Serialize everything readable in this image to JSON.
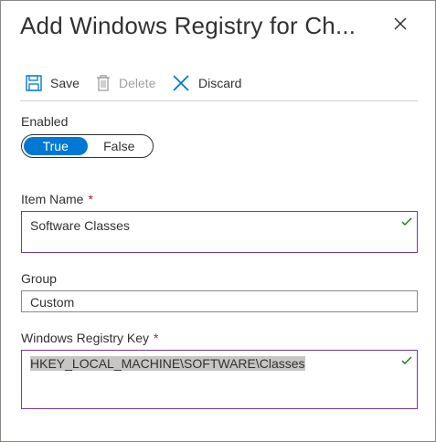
{
  "header": {
    "title": "Add Windows Registry for Ch..."
  },
  "toolbar": {
    "save_label": "Save",
    "delete_label": "Delete",
    "discard_label": "Discard"
  },
  "enabled": {
    "label": "Enabled",
    "true_label": "True",
    "false_label": "False",
    "selected": "True"
  },
  "item_name": {
    "label": "Item Name",
    "required_mark": "*",
    "value": "Software Classes"
  },
  "group": {
    "label": "Group",
    "value": "Custom"
  },
  "registry_key": {
    "label": "Windows Registry Key",
    "required_mark": "*",
    "value": "HKEY_LOCAL_MACHINE\\SOFTWARE\\Classes"
  },
  "colors": {
    "accent": "#0078d4",
    "valid_check": "#107c10",
    "focus_border": "#773b93",
    "required": "#a4262c"
  }
}
